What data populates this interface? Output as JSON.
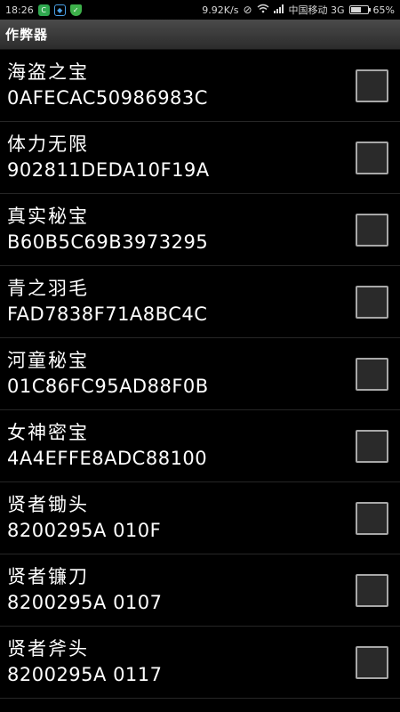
{
  "status_bar": {
    "time": "18:26",
    "speed": "9.92K/s",
    "carrier": "中国移动 3G",
    "battery": "65%",
    "battery_level": 0.65,
    "icons": [
      "app-c-icon",
      "shield-outline-icon",
      "shield-check-icon",
      "alarm-off-icon",
      "wifi-icon",
      "signal-icon",
      "battery-icon"
    ]
  },
  "app": {
    "title": "作弊器"
  },
  "cheats": [
    {
      "name": "海盗之宝",
      "code": "0AFECAC50986983C",
      "checked": false
    },
    {
      "name": "体力无限",
      "code": "902811DEDA10F19A",
      "checked": false
    },
    {
      "name": "真实秘宝",
      "code": "B60B5C69B3973295",
      "checked": false
    },
    {
      "name": "青之羽毛",
      "code": "FAD7838F71A8BC4C",
      "checked": false
    },
    {
      "name": "河童秘宝",
      "code": "01C86FC95AD88F0B",
      "checked": false
    },
    {
      "name": "女神密宝",
      "code": "4A4EFFE8ADC88100",
      "checked": false
    },
    {
      "name": "贤者锄头",
      "code": "8200295A 010F",
      "checked": false
    },
    {
      "name": "贤者镰刀",
      "code": "8200295A 0107",
      "checked": false
    },
    {
      "name": "贤者斧头",
      "code": "8200295A 0117",
      "checked": false
    }
  ]
}
